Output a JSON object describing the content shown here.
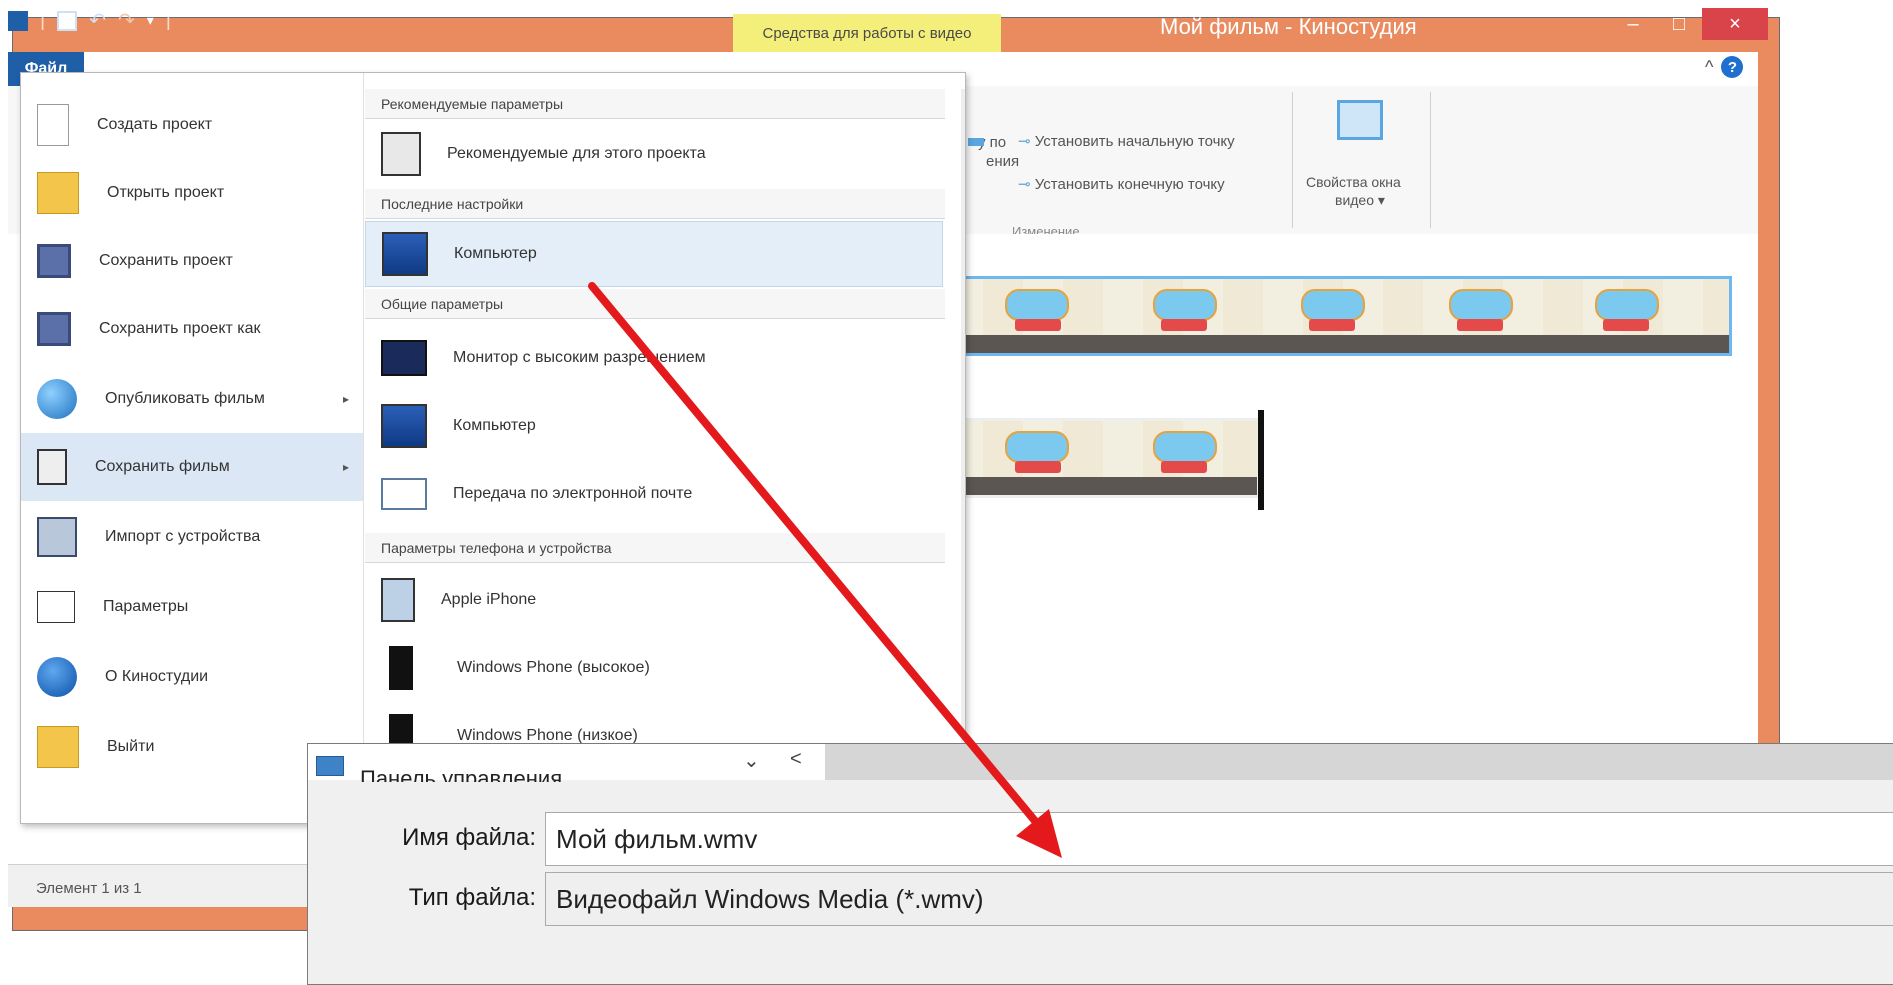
{
  "window": {
    "title": "Мой фильм - Киностудия",
    "contextual_tab": "Средства для работы с видео",
    "controls": {
      "minimize": "–",
      "maximize": "□",
      "close": "×"
    }
  },
  "ribbon": {
    "file_tab": "Файл",
    "help": "?",
    "collapse": "^",
    "set_start_point": "Установить начальную точку",
    "set_end_point": "Установить конечную точку",
    "partial_left_1": "у по",
    "partial_left_2": "ения",
    "group_editing": "Изменение",
    "video_properties_line1": "Свойства окна",
    "video_properties_line2": "видео ▾"
  },
  "status": {
    "text": "Элемент 1 из 1"
  },
  "backstage": {
    "left_items": [
      {
        "label": "Создать проект",
        "icon": "new-project-icon"
      },
      {
        "label": "Открыть проект",
        "icon": "open-project-icon"
      },
      {
        "label": "Сохранить проект",
        "icon": "save-project-icon"
      },
      {
        "label": "Сохранить проект как",
        "icon": "save-project-as-icon"
      },
      {
        "label": "Опубликовать фильм",
        "icon": "publish-globe-icon",
        "arrow": "▸"
      },
      {
        "label": "Сохранить фильм",
        "icon": "save-movie-icon",
        "arrow": "▸"
      },
      {
        "label": "Импорт с устройства",
        "icon": "import-device-icon"
      },
      {
        "label": "Параметры",
        "icon": "options-icon"
      },
      {
        "label": "О Киностудии",
        "icon": "about-info-icon"
      },
      {
        "label": "Выйти",
        "icon": "exit-icon"
      }
    ],
    "sections": {
      "recommended": "Рекомендуемые параметры",
      "recent": "Последние настройки",
      "common": "Общие параметры",
      "phone": "Параметры телефона и устройства"
    },
    "right_items": {
      "recommended_project": "Рекомендуемые для этого проекта",
      "recent_computer": "Компьютер",
      "hd_display": "Монитор с высоким разрешением",
      "computer": "Компьютер",
      "email": "Передача по электронной почте",
      "iphone": "Apple iPhone",
      "windows_phone": "Windows Phone (высокое)",
      "windows_phone_2": "Windows Phone (низкое)"
    }
  },
  "dialog": {
    "title": "Панель управления",
    "nav_dropdown": "⌄",
    "nav_back": "<",
    "filename_label": "Имя файла:",
    "filename_value": "Мой фильм.wmv",
    "filetype_label": "Тип файла:",
    "filetype_value": "Видеофайл Windows Media (*.wmv)"
  },
  "colors": {
    "titlebar": "#e98b5f",
    "file_tab": "#1e5fa8",
    "close_button": "#d9434a",
    "contextual_tab": "#f4ef7b",
    "arrow": "#e3191b"
  }
}
